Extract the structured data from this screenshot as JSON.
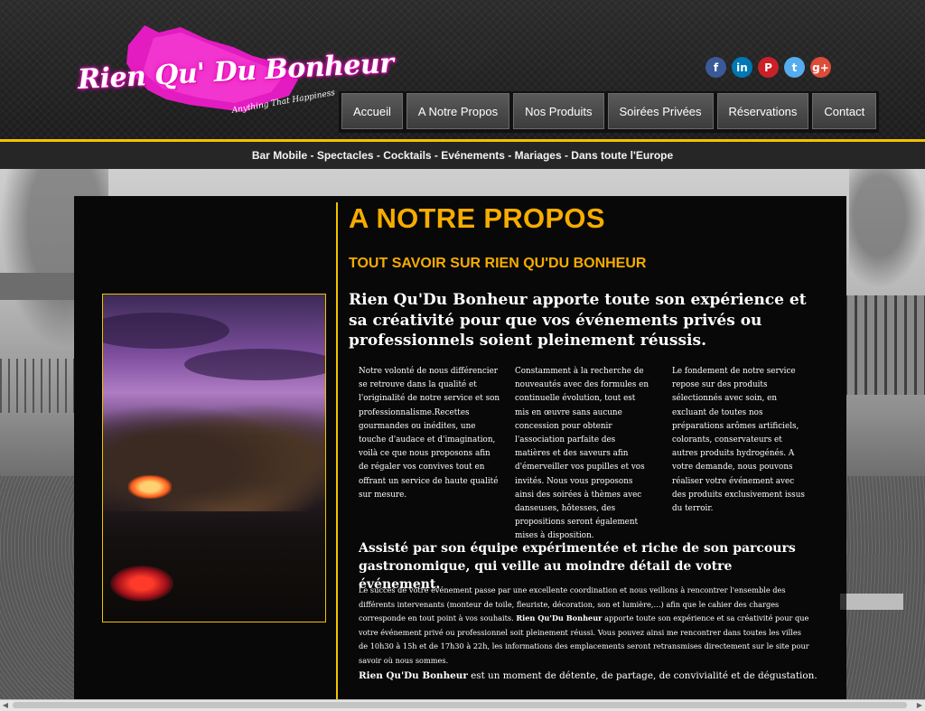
{
  "logo": {
    "name": "Rien Qu' Du Bonheur",
    "tagline": "Anything That Happiness"
  },
  "social": [
    {
      "name": "facebook",
      "glyph": "f",
      "color": "#3b5998"
    },
    {
      "name": "linkedin",
      "glyph": "in",
      "color": "#0077b5"
    },
    {
      "name": "pinterest",
      "glyph": "P",
      "color": "#cb2027"
    },
    {
      "name": "twitter",
      "glyph": "t",
      "color": "#55acee"
    },
    {
      "name": "googleplus",
      "glyph": "g+",
      "color": "#dd4b39"
    }
  ],
  "nav": {
    "items": [
      "Accueil",
      "A Notre Propos",
      "Nos Produits",
      "Soirées Privées",
      "Réservations",
      "Contact"
    ]
  },
  "tagline": "Bar Mobile - Spectacles - Cocktails - Evénements - Mariages - Dans toute l'Europe",
  "content": {
    "title": "A NOTRE PROPOS",
    "subtitle": "TOUT SAVOIR SUR RIEN QU'DU BONHEUR",
    "lead_brand": "Rien Qu'Du Bonheur",
    "lead_rest": " apporte toute son expérience et sa créativité pour que vos événements privés ou professionnels soient pleinement réussis.",
    "col1": "Notre volonté de nous différencier se retrouve dans la qualité et l'originalité de notre service et son professionnalisme.Recettes gourmandes ou inédites, une touche d'audace et d'imagination, voilà ce que nous proposons afin de régaler vos convives tout en offrant un service de haute qualité sur mesure.",
    "col2": "Constamment à la recherche de nouveautés avec des formules en continuelle évolution, tout est mis en œuvre sans aucune concession pour obtenir l'association parfaite des matières et des saveurs afin d'émerveiller vos pupilles et vos invités. Nous vous proposons ainsi des soirées à thèmes avec danseuses, hôtesses, des propositions seront également mises à disposition.",
    "col3": "Le fondement de notre service repose sur des produits sélectionnés avec soin, en excluant de toutes nos préparations arômes artificiels, colorants, conservateurs et autres produits hydrogénés. A votre demande, nous pouvons réaliser votre événement avec des produits exclusivement issus du terroir.",
    "subheading": "Assisté par son équipe expérimentée et riche de son parcours gastronomique, qui veille au moindre détail de votre événement.",
    "body_part1": "Le succès de votre événement passe par une excellente coordination et nous veillons à rencontrer l'ensemble des différents intervenants (monteur de toile, fleuriste, décoration, son et lumière,…) afin que le cahier des charges corresponde en tout point à vos souhaits. ",
    "body_brand": "Rien Qu'Du Bonheur",
    "body_part2": " apporte toute son expérience et sa créativité pour que votre événement privé ou professionnel soit pleinement réussi. Vous pouvez ainsi me rencontrer dans toutes les villes de 10h30 à 15h et de 17h30 à 22h, les informations des emplacements seront retransmises directement sur le site pour savoir où nous sommes.",
    "closing_brand": "Rien Qu'Du Bonheur",
    "closing_rest": " est un moment de détente, de partage, de convivialité et de dégustation."
  },
  "colors": {
    "accent": "#f6ac00",
    "line": "#f2c200",
    "logo_pink": "#e31cc1"
  },
  "icons": {
    "photo": "event-night-photo"
  }
}
